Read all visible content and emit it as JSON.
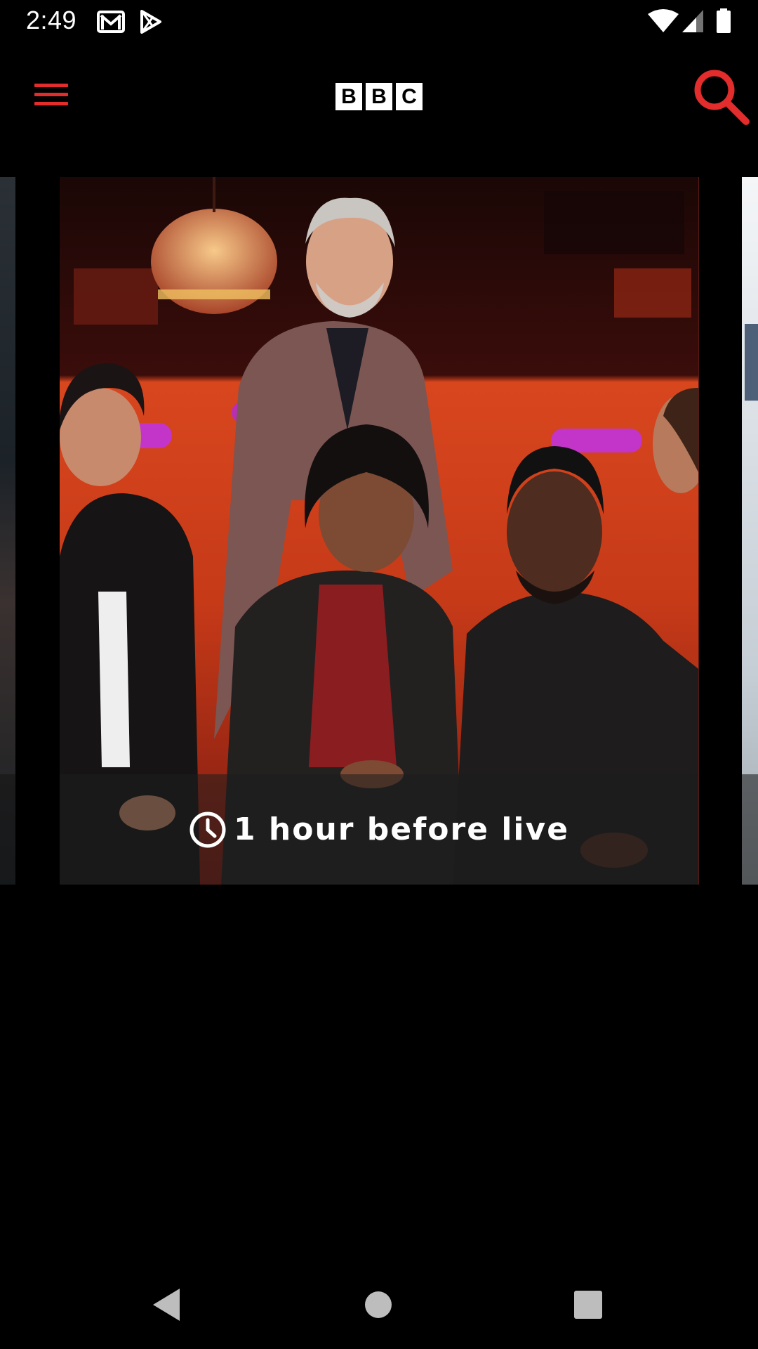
{
  "status_bar": {
    "time": "2:49",
    "left_icons": [
      "gmail-icon",
      "play-store-icon"
    ],
    "right_icons": [
      "wifi-icon",
      "signal-icon",
      "battery-icon"
    ]
  },
  "app_bar": {
    "menu_icon": "hamburger-menu-icon",
    "logo_letters": [
      "B",
      "B",
      "C"
    ],
    "search_icon": "search-icon",
    "accent_color": "#e32c2c"
  },
  "carousel": {
    "featured": {
      "badge_icon": "clock-icon",
      "badge_text": "1 hour before live"
    }
  },
  "nav_bar": {
    "buttons": [
      "back-icon",
      "home-icon",
      "recents-icon"
    ]
  }
}
